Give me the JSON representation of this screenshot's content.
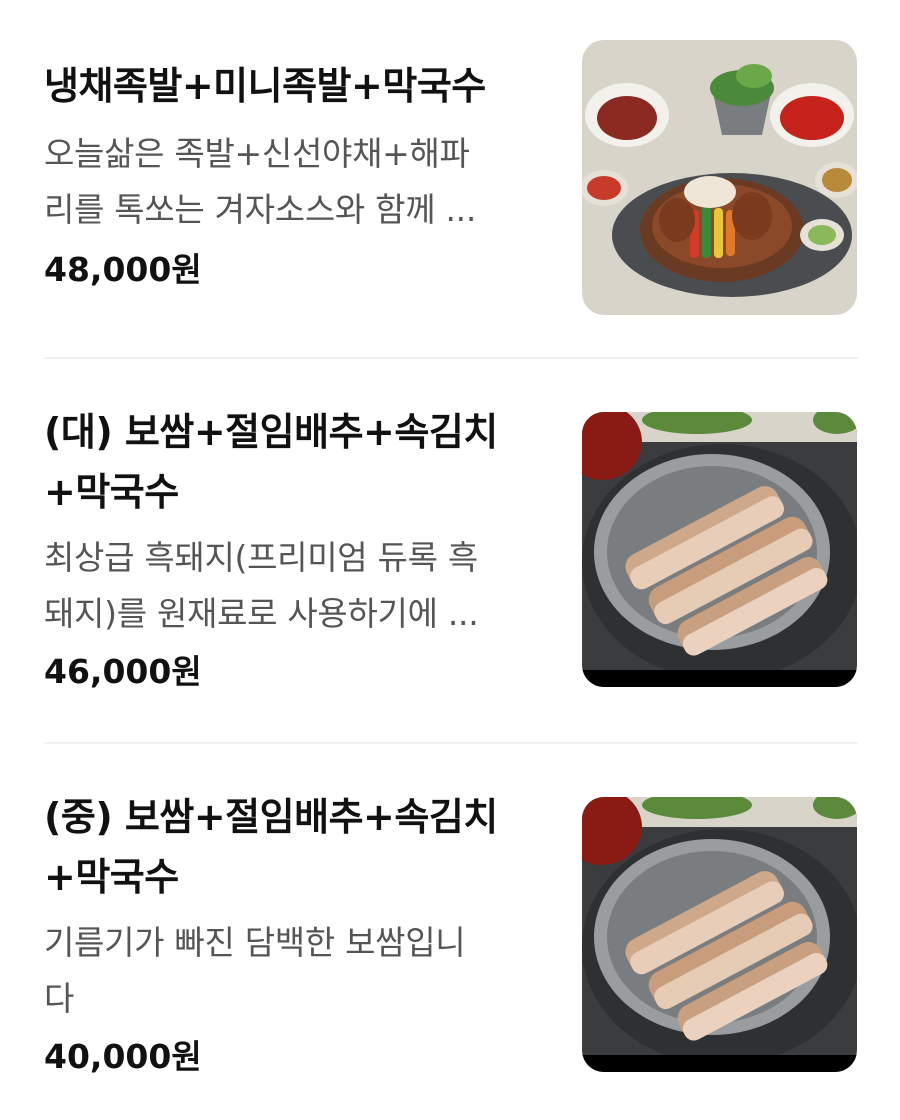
{
  "menu": [
    {
      "title": "냉채족발+미니족발+막국수",
      "description": "오늘삶은 족발+신선야채+해파리를 톡쏘는 겨자소스와 함께 ...",
      "desc_line1": "오늘삶은 족발+신선야채+해파",
      "desc_line2": "리를 톡쏘는 겨자소스와 함께 ...",
      "price": "48,000원",
      "image": "jokbal-platter-photo"
    },
    {
      "title": "(대) 보쌈+절임배추+속김치+막국수",
      "title_line1": "(대) 보쌈+절임배추+속김치",
      "title_line2": "+막국수",
      "description": "최상급 흑돼지(프리미엄 듀록 흑돼지)를 원재료로 사용하기에 ...",
      "desc_line1": "최상급 흑돼지(프리미엄 듀록 흑",
      "desc_line2": "돼지)를 원재료로 사용하기에 ...",
      "price": "46,000원",
      "image": "bossam-platter-photo"
    },
    {
      "title": "(중) 보쌈+절임배추+속김치+막국수",
      "title_line1": "(중) 보쌈+절임배추+속김치",
      "title_line2": "+막국수",
      "description": "기름기가 빠진 담백한 보쌈입니다",
      "desc_line1": "기름기가 빠진 담백한 보쌈입니",
      "desc_line2": "다",
      "price": "40,000원",
      "image": "bossam-platter-photo"
    }
  ]
}
